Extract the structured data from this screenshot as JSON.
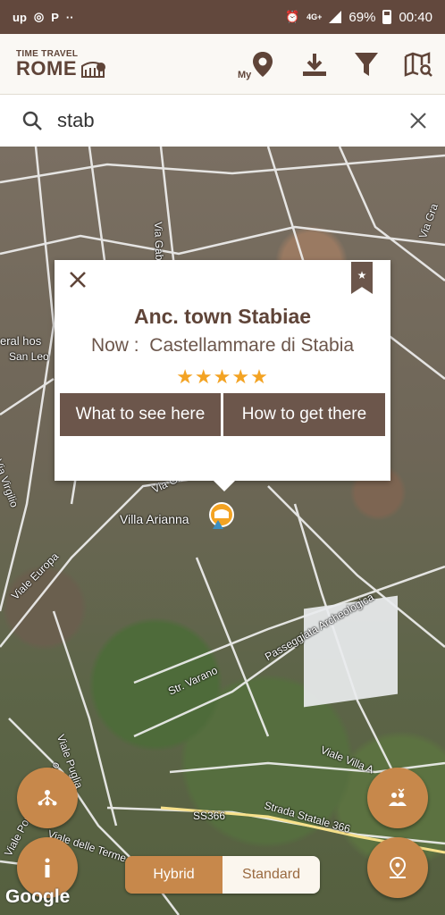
{
  "status_bar": {
    "left_icons": [
      "up-icon",
      "instagram-icon",
      "paypal-icon",
      "more-dots-icon"
    ],
    "battery": "69%",
    "time": "00:40",
    "network": "4G+"
  },
  "app": {
    "logo_line1": "TIME TRAVEL",
    "logo_line2": "ROME",
    "my_label": "My",
    "brand_color": "#5f4438"
  },
  "search": {
    "value": "stab"
  },
  "map": {
    "labels": [
      "eral hos",
      "San Leo",
      "Via Gabri",
      "Via Gra",
      "Via Virgilio",
      "Via Grotta",
      "Villa Arianna",
      "Viale Europa",
      "Passeggiata Archeologica",
      "Str. Varano",
      "Viale Puglia",
      "Viale Ponte Scanzano",
      "Viale delle Terme",
      "SS366",
      "Strada Statale 366",
      "Viale Villa A"
    ],
    "attribution": "Google"
  },
  "popup": {
    "title": "Anc. town Stabiae",
    "now_label": "Now :",
    "now_value": "Castellammare di Stabia",
    "rating": 5,
    "stars": "★★★★★",
    "btn_see": "What to see here",
    "btn_get": "How to get there"
  },
  "map_type": {
    "hybrid": "Hybrid",
    "standard": "Standard",
    "selected": "Hybrid"
  },
  "colors": {
    "accent": "#c7884b",
    "dark": "#6c564b",
    "star": "#f3a323"
  }
}
